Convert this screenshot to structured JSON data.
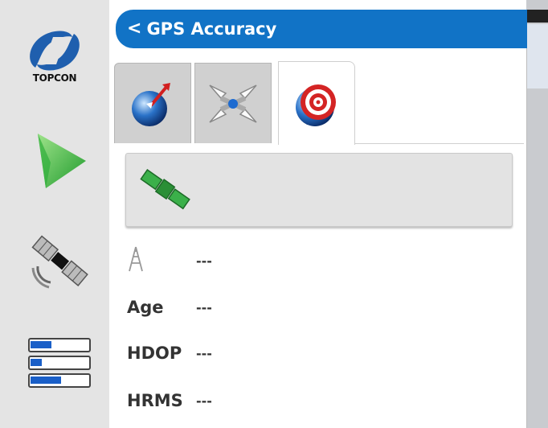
{
  "sidebar": {
    "logo_text": "TOPCON",
    "items": [
      {
        "icon": "topcon-logo-icon"
      },
      {
        "icon": "run-screen-arrow-icon"
      },
      {
        "icon": "satellite-gps-icon"
      },
      {
        "icon": "settings-bars-icon"
      }
    ]
  },
  "header": {
    "back_icon": "<",
    "title": "GPS Accuracy"
  },
  "tabs": [
    {
      "icon": "gps-globe-icon",
      "selected": false
    },
    {
      "icon": "guidance-arrows-icon",
      "selected": false
    },
    {
      "icon": "accuracy-target-icon",
      "selected": true
    }
  ],
  "satellite_button": {
    "icon": "green-satellite-icon"
  },
  "rows": [
    {
      "label": "",
      "icon": "antenna-icon",
      "value": "---"
    },
    {
      "label": "Age",
      "value": "---"
    },
    {
      "label": "HDOP",
      "value": "---"
    },
    {
      "label": "HRMS",
      "value": "---"
    }
  ],
  "colors": {
    "header": "#1173c6",
    "sidebar": "#e4e4e4",
    "tab_inactive": "#d0d0d0"
  }
}
